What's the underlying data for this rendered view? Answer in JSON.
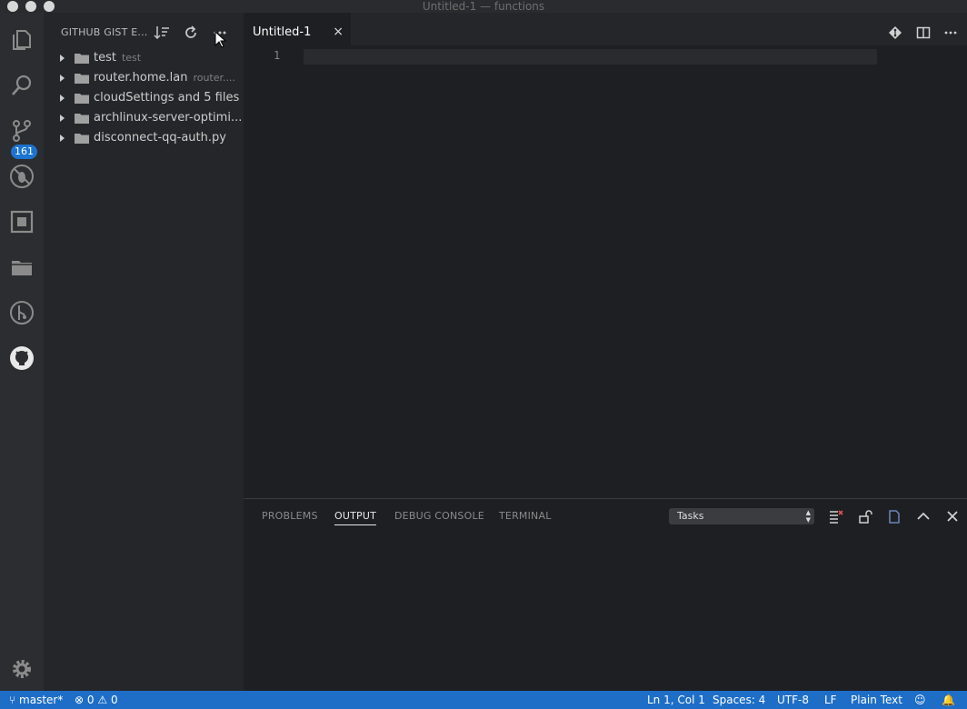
{
  "window": {
    "title": "Untitled-1 — functions"
  },
  "activity_bar": {
    "badge_count": "161"
  },
  "sidebar": {
    "title": "GITHUB GIST E...",
    "items": [
      {
        "label": "test",
        "description": "test"
      },
      {
        "label": "router.home.lan",
        "description": "router...."
      },
      {
        "label": "cloudSettings and 5 files",
        "description": ""
      },
      {
        "label": "archlinux-server-optimi...",
        "description": ""
      },
      {
        "label": "disconnect-qq-auth.py",
        "description": ""
      }
    ]
  },
  "editor": {
    "tab_label": "Untitled-1",
    "tab_close": "×",
    "line_number": "1"
  },
  "panel": {
    "tabs": [
      "PROBLEMS",
      "OUTPUT",
      "DEBUG CONSOLE",
      "TERMINAL"
    ],
    "active_tab": "OUTPUT",
    "output_channel": "Tasks"
  },
  "status_bar": {
    "branch": "master*",
    "errors": "0",
    "warnings": "0",
    "position": "Ln 1, Col 1",
    "indent": "Spaces: 4",
    "encoding": "UTF-8",
    "eol": "LF",
    "language": "Plain Text"
  },
  "colors": {
    "status_bar": "#1e6ec8",
    "badge": "#1c73d0",
    "sidebar_bg": "#252629",
    "editor_bg": "#1e1f22",
    "activity_bg": "#2c2d30"
  }
}
